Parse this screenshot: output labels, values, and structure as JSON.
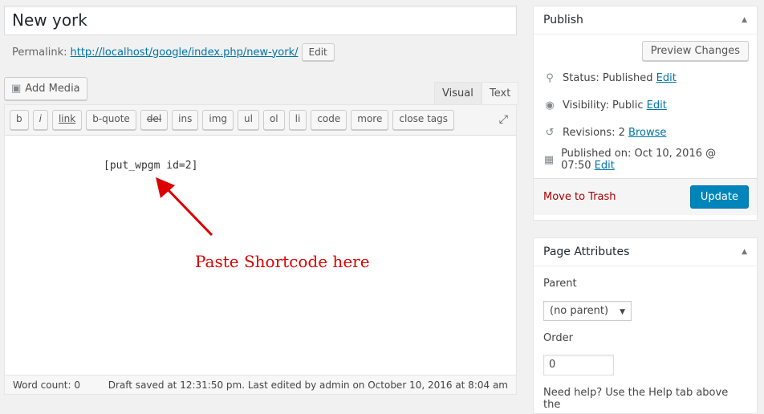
{
  "post": {
    "title": "New york",
    "permalink_label": "Permalink:",
    "permalink": "http://localhost/google/index.php/new-york/",
    "edit": "Edit"
  },
  "media": {
    "add_media": "Add Media"
  },
  "tabs": [
    {
      "label": "Visual",
      "active": false
    },
    {
      "label": "Text",
      "active": true
    }
  ],
  "quicktags": [
    "b",
    "i",
    "link",
    "b-quote",
    "del",
    "ins",
    "img",
    "ul",
    "ol",
    "li",
    "code",
    "more",
    "close tags"
  ],
  "content": {
    "code": "[put_wpgm id=2]",
    "annotation": "Paste Shortcode here",
    "annotation_color": "#dd0000"
  },
  "status": {
    "word_count": "Word count: 0",
    "draft": "Draft saved at 12:31:50 pm. Last edited by admin on October 10, 2016 at 8:04 am"
  },
  "publish": {
    "title": "Publish",
    "preview": "Preview Changes",
    "status": "Status: Published",
    "status_edit": "Edit",
    "visibility": "Visibility: Public",
    "visibility_edit": "Edit",
    "revisions": "Revisions: 2",
    "revisions_link": "Browse",
    "published": "Published on: Oct 10, 2016 @ 07:50",
    "published_edit": "Edit",
    "trash": "Move to Trash",
    "update": "Update"
  },
  "attributes": {
    "title": "Page Attributes",
    "parent_label": "Parent",
    "parent_value": "(no parent)",
    "order_label": "Order",
    "order_value": "0",
    "help": "Need help? Use the Help tab above the"
  }
}
